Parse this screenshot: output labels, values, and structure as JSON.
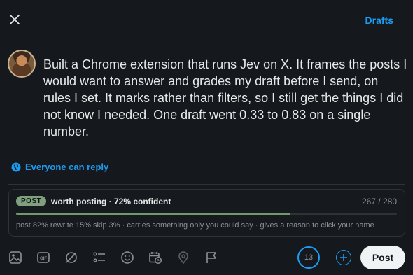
{
  "header": {
    "close_icon": "close-icon",
    "drafts_label": "Drafts"
  },
  "composer": {
    "text": "Built a Chrome extension that runs Jev on X. It frames the posts I would want to answer and grades my draft before I send, on rules I set. It marks rather than filters, so I still get the things I did not know I needed. One draft went 0.33 to 0.83 on a single number.",
    "reply_setting": "Everyone can reply"
  },
  "grader": {
    "badge": "POST",
    "verdict": "worth posting · 72% confident",
    "char_count": "267 / 280",
    "confidence_fraction": 0.72,
    "details": "post 82% rewrite 15% skip 3% · carries something only you could say · gives a reason to click your name"
  },
  "toolbar": {
    "icons": [
      "image-icon",
      "gif-icon",
      "grok-icon",
      "list-icon",
      "emoji-icon",
      "schedule-icon",
      "location-icon",
      "flag-icon"
    ],
    "chars_remaining": "13",
    "post_label": "Post"
  },
  "colors": {
    "accent": "#1d9bf0",
    "badge_green": "#7fa07f",
    "bar_fill": "#6f9a6b"
  }
}
